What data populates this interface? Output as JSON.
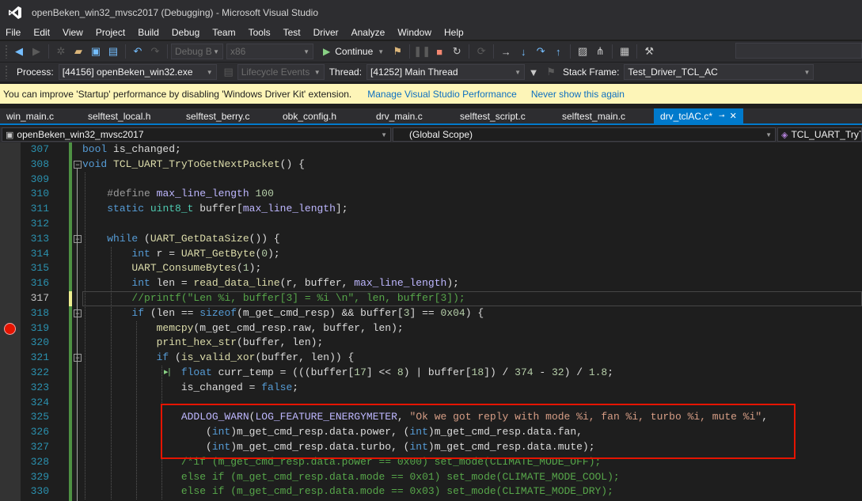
{
  "window": {
    "title": "openBeken_win32_mvsc2017 (Debugging) - Microsoft Visual Studio"
  },
  "menu": [
    "File",
    "Edit",
    "View",
    "Project",
    "Build",
    "Debug",
    "Team",
    "Tools",
    "Test",
    "Driver",
    "Analyze",
    "Window",
    "Help"
  ],
  "toolbar": {
    "config": "Debug B",
    "platform": "x86",
    "continue_label": "Continue",
    "process_label": "Process:",
    "process_value": "[44156] openBeken_win32.exe",
    "lifecycle_label": "Lifecycle Events",
    "thread_label": "Thread:",
    "thread_value": "[41252] Main Thread",
    "stackframe_label": "Stack Frame:",
    "stackframe_value": "Test_Driver_TCL_AC"
  },
  "infobar": {
    "message": "You can improve 'Startup' performance by disabling 'Windows Driver Kit' extension.",
    "link_manage": "Manage Visual Studio Performance",
    "link_never": "Never show this again"
  },
  "tabs": [
    {
      "label": "win_main.c",
      "active": false
    },
    {
      "label": "selftest_local.h",
      "active": false
    },
    {
      "label": "selftest_berry.c",
      "active": false
    },
    {
      "label": "obk_config.h",
      "active": false
    },
    {
      "label": "drv_main.c",
      "active": false
    },
    {
      "label": "selftest_script.c",
      "active": false
    },
    {
      "label": "selftest_main.c",
      "active": false
    },
    {
      "label": "drv_tclAC.c*",
      "active": true
    }
  ],
  "navbar": {
    "project": "openBeken_win32_mvsc2017",
    "scope": "(Global Scope)",
    "member": "TCL_UART_TryToG"
  },
  "code": {
    "current_line": 317,
    "breakpoint_line": 319,
    "lines": [
      {
        "n": 307,
        "html": "<span class='kw'>bool</span> is_changed;"
      },
      {
        "n": 308,
        "html": "<span class='kw'>void</span> <span class='fn'>TCL_UART_TryToGetNextPacket</span>() {"
      },
      {
        "n": 309,
        "html": ""
      },
      {
        "n": 310,
        "html": "    <span class='pp'>#define</span> <span class='macro'>max_line_length</span> <span class='num'>100</span>"
      },
      {
        "n": 311,
        "html": "    <span class='kw'>static</span> <span class='type'>uint8_t</span> buffer[<span class='macro'>max_line_length</span>];"
      },
      {
        "n": 312,
        "html": ""
      },
      {
        "n": 313,
        "html": "    <span class='kw'>while</span> (<span class='fn'>UART_GetDataSize</span>()) {"
      },
      {
        "n": 314,
        "html": "        <span class='kw'>int</span> r = <span class='fn'>UART_GetByte</span>(<span class='num'>0</span>);"
      },
      {
        "n": 315,
        "html": "        <span class='fn'>UART_ConsumeBytes</span>(<span class='num'>1</span>);"
      },
      {
        "n": 316,
        "html": "        <span class='kw'>int</span> len = <span class='fn'>read_data_line</span>(r, buffer, <span class='macro'>max_line_length</span>);"
      },
      {
        "n": 317,
        "html": "        <span class='cmt'>//printf(\"Len %i, buffer[3] = %i \\n\", len, buffer[3]);</span>"
      },
      {
        "n": 318,
        "html": "        <span class='kw'>if</span> (len == <span class='kw'>sizeof</span>(m_get_cmd_resp) &amp;&amp; buffer[<span class='num'>3</span>] == <span class='num'>0x04</span>) {"
      },
      {
        "n": 319,
        "html": "            <span class='fn'>memcpy</span>(m_get_cmd_resp.raw, buffer, len);"
      },
      {
        "n": 320,
        "html": "            <span class='fn'>print_hex_str</span>(buffer, len);"
      },
      {
        "n": 321,
        "html": "            <span class='kw'>if</span> (<span class='fn'>is_valid_xor</span>(buffer, len)) {"
      },
      {
        "n": 322,
        "html": "                <span class='kw'>float</span> curr_temp = (((buffer[<span class='num'>17</span>] &lt;&lt; <span class='num'>8</span>) | buffer[<span class='num'>18</span>]) / <span class='num'>374</span> - <span class='num'>32</span>) / <span class='num'>1.8</span>;"
      },
      {
        "n": 323,
        "html": "                is_changed = <span class='kw'>false</span>;"
      },
      {
        "n": 324,
        "html": ""
      },
      {
        "n": 325,
        "html": "                <span class='macro'>ADDLOG_WARN</span>(<span class='macro'>LOG_FEATURE_ENERGYMETER</span>, <span class='str'>\"Ok we got reply with mode %i, fan %i, turbo %i, mute %i\"</span>,"
      },
      {
        "n": 326,
        "html": "                    (<span class='kw'>int</span>)m_get_cmd_resp.data.power, (<span class='kw'>int</span>)m_get_cmd_resp.data.fan,"
      },
      {
        "n": 327,
        "html": "                    (<span class='kw'>int</span>)m_get_cmd_resp.data.turbo, (<span class='kw'>int</span>)m_get_cmd_resp.data.mute);"
      },
      {
        "n": 328,
        "html": "                <span class='cmt'>/*if (m_get_cmd_resp.data.power == 0x00) set_mode(CLIMATE_MODE_OFF);</span>"
      },
      {
        "n": 329,
        "html": "<span class='cmt'>                else if (m_get_cmd_resp.data.mode == 0x01) set_mode(CLIMATE_MODE_COOL);</span>"
      },
      {
        "n": 330,
        "html": "<span class='cmt'>                else if (m_get_cmd_resp.data.mode == 0x03) set_mode(CLIMATE_MODE_DRY);</span>"
      }
    ]
  }
}
